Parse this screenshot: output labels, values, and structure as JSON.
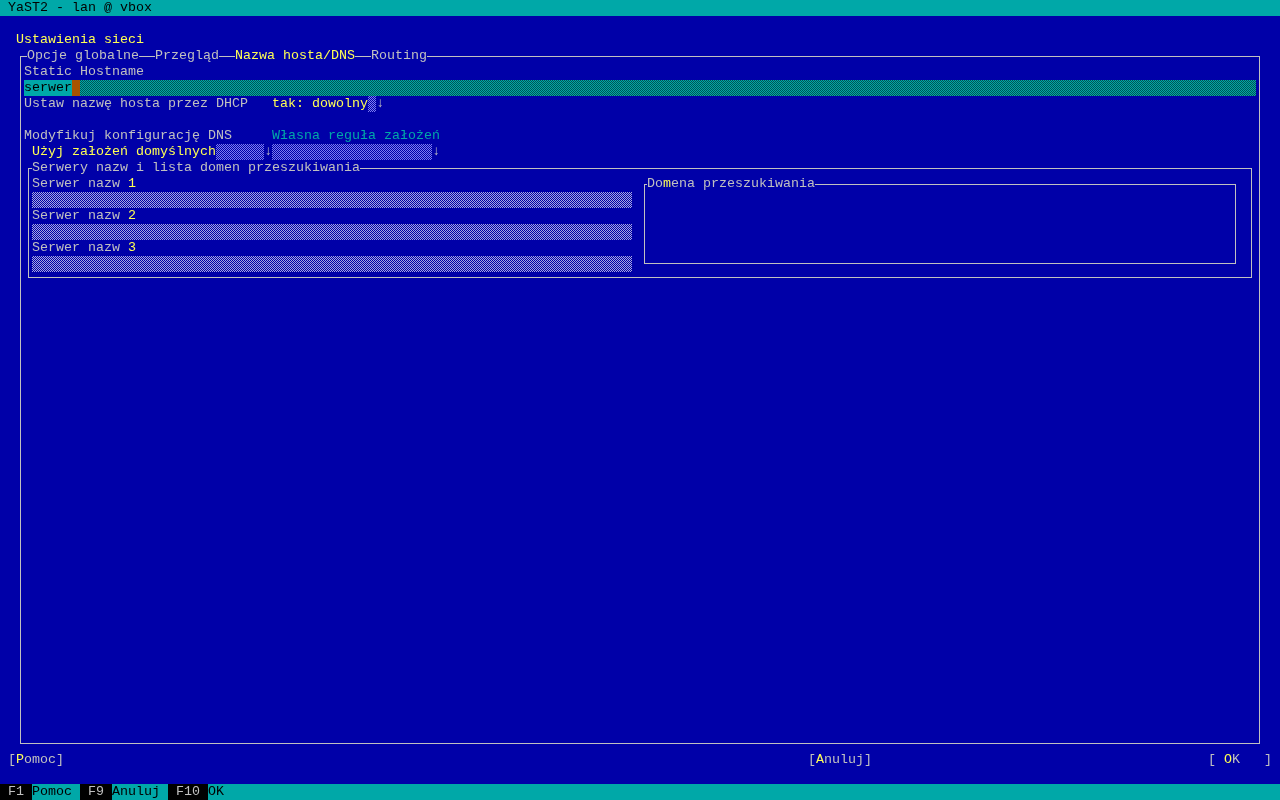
{
  "window": {
    "title": "YaST2 - lan @ vbox"
  },
  "dialog": {
    "heading": "Ustawienia sieci"
  },
  "tabs": [
    {
      "label": "Opcje globalne",
      "selected": false
    },
    {
      "label": "Przegląd",
      "selected": false
    },
    {
      "label": "Nazwa hosta/DNS",
      "selected": true
    },
    {
      "label": "Routing",
      "selected": false
    }
  ],
  "hostname": {
    "label": "Static Hostname",
    "value": "serwer"
  },
  "dhcp": {
    "label": "Ustaw nazwę hosta przez DHCP",
    "value": "tak: dowolny",
    "arrow": "↓"
  },
  "dns": {
    "label": "Modyfikuj konfigurację DNS",
    "value": "Użyj założeń domyślnych",
    "arrow": "↓",
    "policy": {
      "label": "Własna reguła założeń",
      "arrow": "↓"
    }
  },
  "name_servers": {
    "title": "Serwery nazw i lista domen przeszukiwania",
    "servers": [
      {
        "label": "Serwer nazw **1**"
      },
      {
        "label": "Serwer nazw **2**"
      },
      {
        "label": "Serwer nazw **3**"
      }
    ],
    "search_domains": {
      "title": "Do**m**ena przeszukiwania"
    }
  },
  "buttons": [
    {
      "label": "[**P**omoc]"
    },
    {
      "label": "[**A**nuluj]"
    },
    {
      "label": "[ **O**K   ]"
    }
  ],
  "function_keys": [
    {
      "key": "F1",
      "label": "Pomoc"
    },
    {
      "key": "F9",
      "label": "Anuluj"
    },
    {
      "key": "F10",
      "label": "OK"
    }
  ]
}
